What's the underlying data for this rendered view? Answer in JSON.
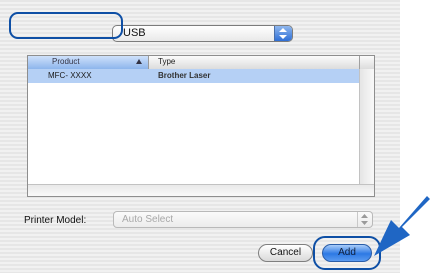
{
  "connection_popup": {
    "value": "USB"
  },
  "printer_table": {
    "columns": {
      "product": "Product",
      "type": "Type"
    },
    "rows": [
      {
        "product": "MFC- XXXX",
        "type": "Brother Laser"
      }
    ]
  },
  "printer_model": {
    "label": "Printer Model:",
    "value": "Auto Select"
  },
  "buttons": {
    "cancel": "Cancel",
    "add": "Add"
  },
  "colors": {
    "callout": "#1f66c4",
    "selection": "#b5d0f5",
    "accent": "#2d79e4"
  }
}
